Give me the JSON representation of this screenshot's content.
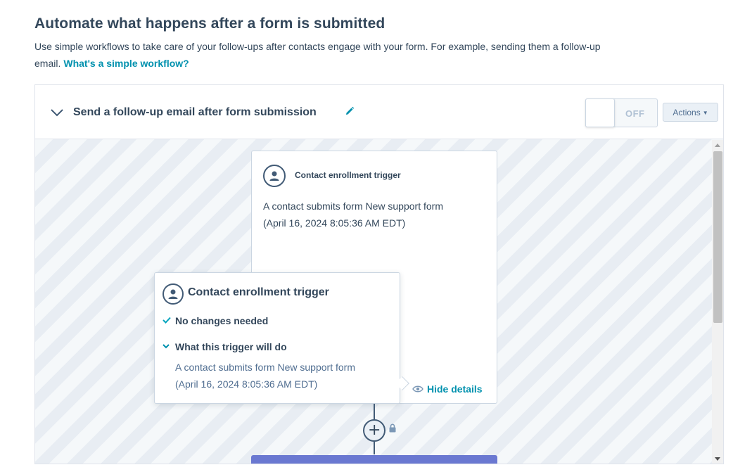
{
  "page": {
    "heading": "Automate what happens after a form is submitted",
    "intro_text": "Use simple workflows to take care of your follow-ups after contacts engage with your form. For example, sending them a follow-up email.",
    "intro_link": "What's a simple workflow?"
  },
  "workflow": {
    "title": "Send a follow-up email after form submission",
    "toggle_label": "OFF",
    "actions_label": "Actions"
  },
  "trigger_card": {
    "title": "Contact enrollment trigger",
    "description_line1": "A contact submits form New support form",
    "description_line2": "(April 16, 2024 8:05:36 AM EDT)",
    "hide_details": "Hide details"
  },
  "popover": {
    "title": "Contact enrollment trigger",
    "status": "No changes needed",
    "section_title": "What this trigger will do",
    "description_line1": "A contact submits form New support form",
    "description_line2": "(April 16, 2024 8:05:36 AM EDT)"
  },
  "colors": {
    "text": "#33475b",
    "link": "#0091ae",
    "check": "#00a4bd",
    "next_action": "#6a78d1"
  },
  "icons": {
    "collapse": "chevron-down-icon",
    "edit": "pencil-icon",
    "contact": "contact-avatar-icon",
    "status": "checkmark-icon",
    "expand": "chevron-down-small-icon",
    "details": "eye-icon",
    "add": "plus-icon",
    "locked": "lock-icon"
  }
}
